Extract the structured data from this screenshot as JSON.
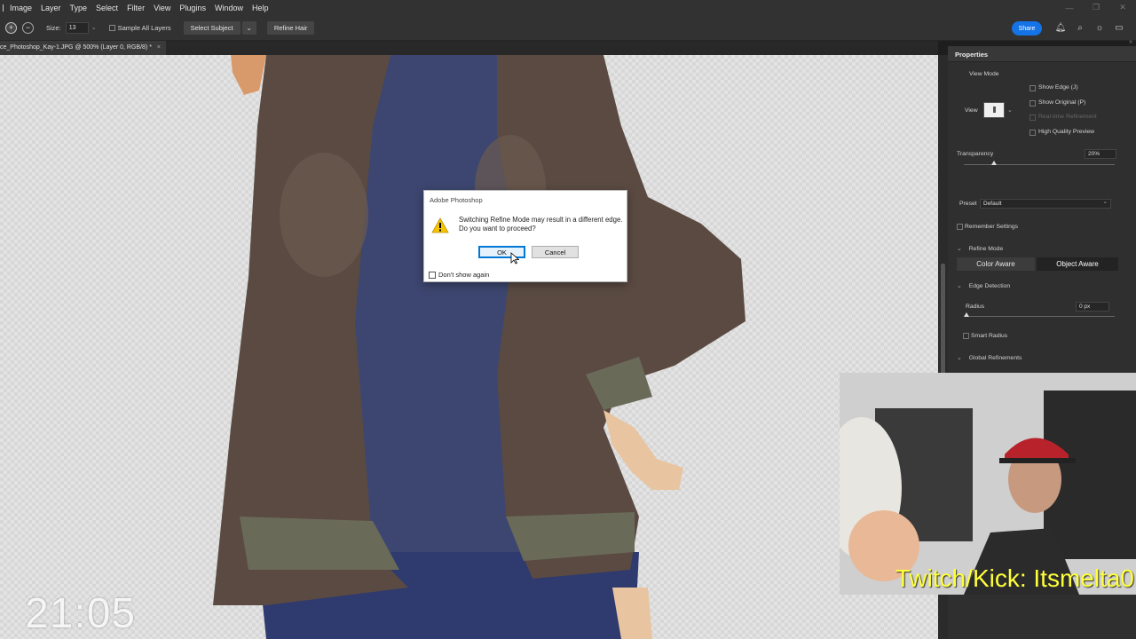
{
  "menubar": {
    "items": [
      "Image",
      "Layer",
      "Type",
      "Select",
      "Filter",
      "View",
      "Plugins",
      "Window",
      "Help"
    ]
  },
  "options_bar": {
    "size_label": "Size:",
    "size_value": "13",
    "sample_all_layers": "Sample All Layers",
    "select_subject": "Select Subject",
    "refine_hair": "Refine Hair",
    "share": "Share"
  },
  "document": {
    "tab_title": "ce_Photoshop_Kay-1.JPG @ 500% (Layer 0, RGB/8) *",
    "close": "×"
  },
  "properties": {
    "title": "Properties",
    "view_mode": "View Mode",
    "view": "View",
    "show_edge": "Show Edge (J)",
    "show_original": "Show Original (P)",
    "realtime_refinement": "Real-time Refinement",
    "high_quality_preview": "High Quality Preview",
    "transparency_label": "Transparency",
    "transparency_value": "20%",
    "transparency_fraction": 0.2,
    "preset_label": "Preset",
    "preset_value": "Default",
    "remember_settings": "Remember Settings",
    "refine_mode": "Refine Mode",
    "color_aware": "Color Aware",
    "object_aware": "Object Aware",
    "edge_detection": "Edge Detection",
    "radius_label": "Radius",
    "radius_value": "0 px",
    "smart_radius": "Smart Radius",
    "global_refinements": "Global Refinements"
  },
  "dialog": {
    "title": "Adobe Photoshop",
    "message": "Switching Refine Mode may result in a different edge. Do you want to proceed?",
    "ok": "OK",
    "cancel": "Cancel",
    "dont_show_again": "Don't show again"
  },
  "overlay": {
    "timer": "21:05",
    "webcam_caption": "Twitch/Kick: Itsmelta0"
  },
  "colors": {
    "accent_blue": "#1473e6",
    "caption_yellow": "#ffff3a",
    "panel_bg": "#2f2f2f"
  }
}
